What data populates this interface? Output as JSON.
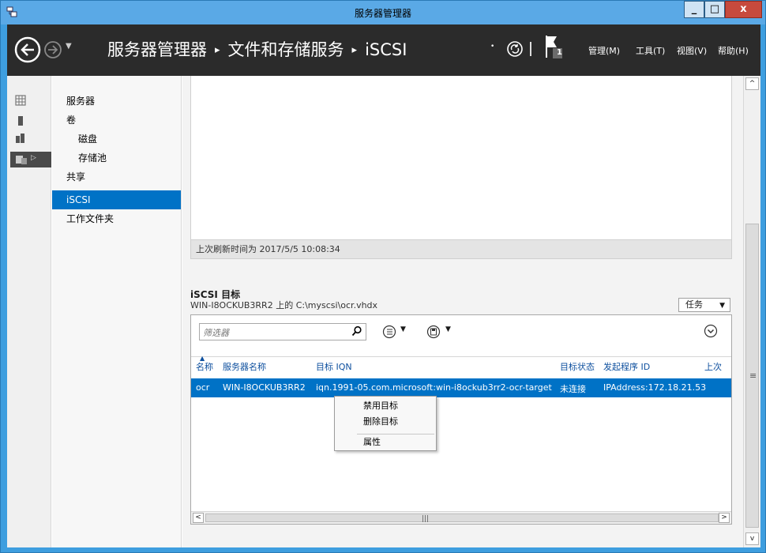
{
  "window": {
    "title": "服务器管理器"
  },
  "header": {
    "breadcrumb": [
      "服务器管理器",
      "文件和存储服务",
      "iSCSI"
    ],
    "notification_count": "1",
    "menus": [
      "管理(M)",
      "工具(T)",
      "视图(V)",
      "帮助(H)"
    ]
  },
  "sidebar": {
    "items": [
      {
        "label": "服务器",
        "level": 0
      },
      {
        "label": "卷",
        "level": 0
      },
      {
        "label": "磁盘",
        "level": 1
      },
      {
        "label": "存储池",
        "level": 1
      },
      {
        "label": "共享",
        "level": 0
      },
      {
        "label": "iSCSI",
        "level": 0,
        "selected": true
      },
      {
        "label": "工作文件夹",
        "level": 0
      }
    ]
  },
  "top_panel": {
    "last_refresh": "上次刷新时间为 2017/5/5 10:08:34"
  },
  "targets": {
    "title": "iSCSI 目标",
    "subtitle": "WIN-I8OCKUB3RR2 上的 C:\\myscsi\\ocr.vhdx",
    "tasks_label": "任务",
    "filter_placeholder": "筛选器",
    "columns": [
      "名称",
      "服务器名称",
      "目标 IQN",
      "目标状态",
      "发起程序 ID",
      "上次"
    ],
    "rows": [
      {
        "name": "ocr",
        "server": "WIN-I8OCKUB3RR2",
        "iqn": "iqn.1991-05.com.microsoft:win-i8ockub3rr2-ocr-target",
        "status": "未连接",
        "initiator": "IPAddress:172.18.21.53"
      }
    ]
  },
  "context_menu": {
    "items": [
      "禁用目标",
      "删除目标",
      "属性"
    ]
  },
  "colors": {
    "accent": "#0072c6",
    "header_bg": "#2b2b2b",
    "title_bar": "#5aa9e6"
  }
}
